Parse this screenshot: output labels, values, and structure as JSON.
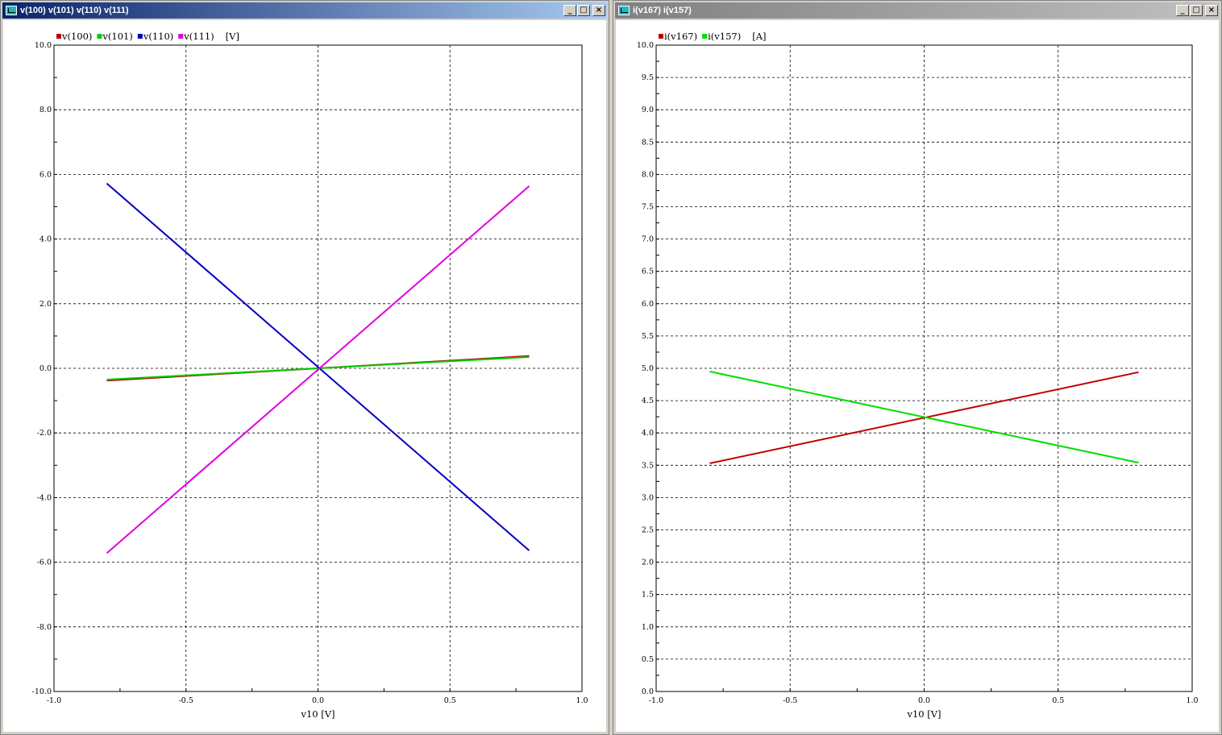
{
  "windows": [
    {
      "title": "v(100) v(101) v(110) v(111)",
      "icon": "plot-window-icon"
    },
    {
      "title": "i(v167) i(v157)",
      "icon": "plot-window-icon"
    }
  ],
  "buttons": {
    "minimize": "_",
    "maximize": "□",
    "close": "×"
  },
  "chart_data": [
    {
      "type": "line",
      "legend_unit": "[V]",
      "xlabel": "v10 [V]",
      "xlim": [
        -1.0,
        1.0
      ],
      "ylim": [
        -10.0,
        10.0
      ],
      "xticks": [
        -1.0,
        -0.5,
        0.0,
        0.5,
        1.0
      ],
      "xtick_labels": [
        "-1.0",
        "-0.5",
        "0.0",
        "0.5",
        "1.0"
      ],
      "yticks": [
        -10.0,
        -8.0,
        -6.0,
        -4.0,
        -2.0,
        0.0,
        2.0,
        4.0,
        6.0,
        8.0,
        10.0
      ],
      "ytick_labels": [
        "-10.0",
        "-8.0",
        "-6.0",
        "-4.0",
        "-2.0",
        "0.0",
        "2.0",
        "4.0",
        "6.0",
        "8.0",
        "10.0"
      ],
      "grid": true,
      "legend_position": "top-left",
      "series": [
        {
          "name": "v(100)",
          "color": "#c00000",
          "x": [
            -0.8,
            0.8
          ],
          "y": [
            -0.38,
            0.38
          ]
        },
        {
          "name": "v(101)",
          "color": "#00cc00",
          "x": [
            -0.8,
            0.8
          ],
          "y": [
            -0.35,
            0.35
          ]
        },
        {
          "name": "v(110)",
          "color": "#0000c0",
          "x": [
            -0.8,
            0.8
          ],
          "y": [
            5.72,
            -5.64
          ]
        },
        {
          "name": "v(111)",
          "color": "#e000e0",
          "x": [
            -0.8,
            0.8
          ],
          "y": [
            -5.72,
            5.64
          ]
        }
      ]
    },
    {
      "type": "line",
      "legend_unit": "[A]",
      "xlabel": "v10 [V]",
      "xlim": [
        -1.0,
        1.0
      ],
      "ylim": [
        0.0,
        10.0
      ],
      "xticks": [
        -1.0,
        -0.5,
        0.0,
        0.5,
        1.0
      ],
      "xtick_labels": [
        "-1.0",
        "-0.5",
        "0.0",
        "0.5",
        "1.0"
      ],
      "yticks": [
        0.0,
        0.5,
        1.0,
        1.5,
        2.0,
        2.5,
        3.0,
        3.5,
        4.0,
        4.5,
        5.0,
        5.5,
        6.0,
        6.5,
        7.0,
        7.5,
        8.0,
        8.5,
        9.0,
        9.5,
        10.0
      ],
      "ytick_labels": [
        "0.0",
        "0.5",
        "1.0",
        "1.5",
        "2.0",
        "2.5",
        "3.0",
        "3.5",
        "4.0",
        "4.5",
        "5.0",
        "5.5",
        "6.0",
        "6.5",
        "7.0",
        "7.5",
        "8.0",
        "8.5",
        "9.0",
        "9.5",
        "10.0"
      ],
      "grid": true,
      "legend_position": "top-left",
      "series": [
        {
          "name": "i(v167)",
          "color": "#c00000",
          "x": [
            -0.8,
            0.8
          ],
          "y": [
            3.53,
            4.94
          ]
        },
        {
          "name": "i(v157)",
          "color": "#00dd00",
          "x": [
            -0.8,
            0.8
          ],
          "y": [
            4.95,
            3.54
          ]
        }
      ]
    }
  ]
}
